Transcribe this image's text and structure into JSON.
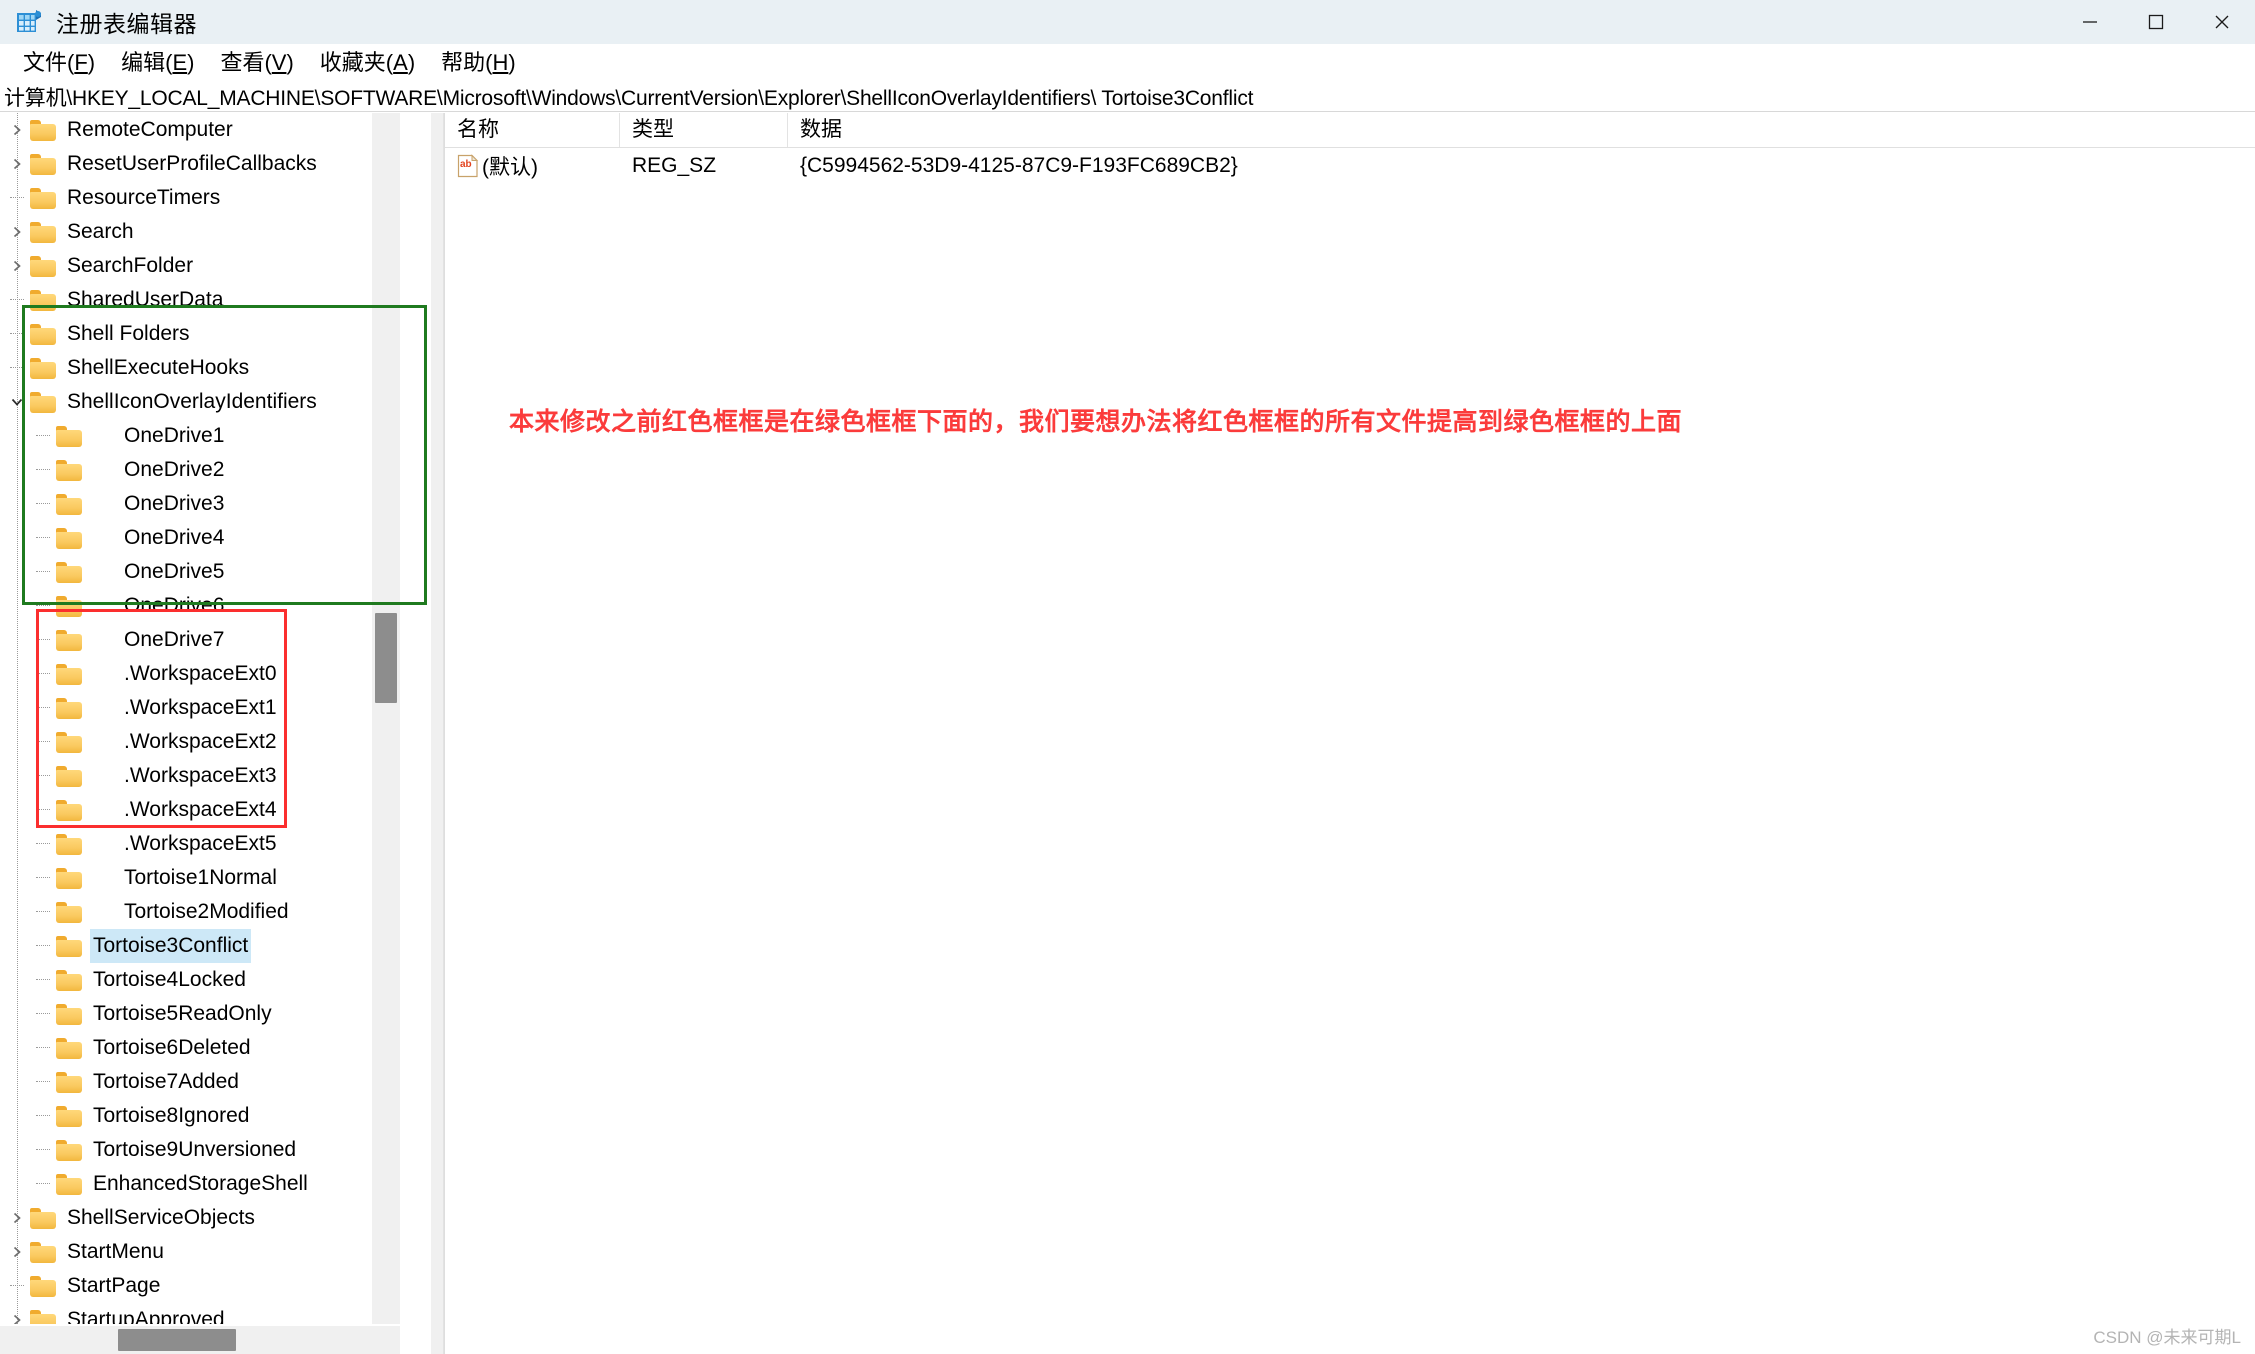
{
  "window": {
    "title": "注册表编辑器",
    "icon": "registry-editor-icon",
    "minimize_label": "—",
    "maximize_label": "☐",
    "close_label": "✕"
  },
  "menubar": {
    "items": [
      {
        "text": "文件(F)",
        "before": "文件(",
        "key": "F",
        "after": ")"
      },
      {
        "text": "编辑(E)",
        "before": "编辑(",
        "key": "E",
        "after": ")"
      },
      {
        "text": "查看(V)",
        "before": "查看(",
        "key": "V",
        "after": ")"
      },
      {
        "text": "收藏夹(A)",
        "before": "收藏夹(",
        "key": "A",
        "after": ")"
      },
      {
        "text": "帮助(H)",
        "before": "帮助(",
        "key": "H",
        "after": ")"
      }
    ]
  },
  "address": {
    "path": "计算机\\HKEY_LOCAL_MACHINE\\SOFTWARE\\Microsoft\\Windows\\CurrentVersion\\Explorer\\ShellIconOverlayIdentifiers\\ Tortoise3Conflict"
  },
  "tree": {
    "items": [
      {
        "label": "RemoteComputer",
        "level": 0,
        "expander": "collapsed"
      },
      {
        "label": "ResetUserProfileCallbacks",
        "level": 0,
        "expander": "collapsed"
      },
      {
        "label": "ResourceTimers",
        "level": 0,
        "expander": "none"
      },
      {
        "label": "Search",
        "level": 0,
        "expander": "collapsed"
      },
      {
        "label": "SearchFolder",
        "level": 0,
        "expander": "collapsed"
      },
      {
        "label": "SharedUserData",
        "level": 0,
        "expander": "none"
      },
      {
        "label": "Shell Folders",
        "level": 0,
        "expander": "none"
      },
      {
        "label": "ShellExecuteHooks",
        "level": 0,
        "expander": "none"
      },
      {
        "label": "ShellIconOverlayIdentifiers",
        "level": 0,
        "expander": "expanded"
      },
      {
        "label": "OneDrive1",
        "level": 1,
        "expander": "none",
        "extra_indent": true
      },
      {
        "label": "OneDrive2",
        "level": 1,
        "expander": "none",
        "extra_indent": true
      },
      {
        "label": "OneDrive3",
        "level": 1,
        "expander": "none",
        "extra_indent": true
      },
      {
        "label": "OneDrive4",
        "level": 1,
        "expander": "none",
        "extra_indent": true
      },
      {
        "label": "OneDrive5",
        "level": 1,
        "expander": "none",
        "extra_indent": true
      },
      {
        "label": "OneDrive6",
        "level": 1,
        "expander": "none",
        "extra_indent": true
      },
      {
        "label": "OneDrive7",
        "level": 1,
        "expander": "none",
        "extra_indent": true
      },
      {
        "label": ".WorkspaceExt0",
        "level": 1,
        "expander": "none",
        "extra_indent": true
      },
      {
        "label": ".WorkspaceExt1",
        "level": 1,
        "expander": "none",
        "extra_indent": true
      },
      {
        "label": ".WorkspaceExt2",
        "level": 1,
        "expander": "none",
        "extra_indent": true
      },
      {
        "label": ".WorkspaceExt3",
        "level": 1,
        "expander": "none",
        "extra_indent": true
      },
      {
        "label": ".WorkspaceExt4",
        "level": 1,
        "expander": "none",
        "extra_indent": true
      },
      {
        "label": ".WorkspaceExt5",
        "level": 1,
        "expander": "none",
        "extra_indent": true
      },
      {
        "label": "Tortoise1Normal",
        "level": 1,
        "expander": "none",
        "extra_indent": true
      },
      {
        "label": "Tortoise2Modified",
        "level": 1,
        "expander": "none",
        "extra_indent": true
      },
      {
        "label": "Tortoise3Conflict",
        "level": 1,
        "expander": "none",
        "selected": true
      },
      {
        "label": "Tortoise4Locked",
        "level": 1,
        "expander": "none"
      },
      {
        "label": "Tortoise5ReadOnly",
        "level": 1,
        "expander": "none"
      },
      {
        "label": "Tortoise6Deleted",
        "level": 1,
        "expander": "none"
      },
      {
        "label": "Tortoise7Added",
        "level": 1,
        "expander": "none"
      },
      {
        "label": "Tortoise8Ignored",
        "level": 1,
        "expander": "none"
      },
      {
        "label": "Tortoise9Unversioned",
        "level": 1,
        "expander": "none"
      },
      {
        "label": "EnhancedStorageShell",
        "level": 1,
        "expander": "none"
      },
      {
        "label": "ShellServiceObjects",
        "level": 0,
        "expander": "collapsed"
      },
      {
        "label": "StartMenu",
        "level": 0,
        "expander": "collapsed"
      },
      {
        "label": "StartPage",
        "level": 0,
        "expander": "none"
      },
      {
        "label": "StartupApproved",
        "level": 0,
        "expander": "collapsed"
      }
    ]
  },
  "listview": {
    "columns": [
      "名称",
      "类型",
      "数据"
    ],
    "rows": [
      {
        "icon": "ab-string-value-icon",
        "name": "(默认)",
        "type": "REG_SZ",
        "data": "{C5994562-53D9-4125-87C9-F193FC689CB2}"
      }
    ]
  },
  "annotations": {
    "note_text": "本来修改之前红色框框是在绿色框框下面的，我们要想办法将红色框框的所有文件提高到绿色框框的上面",
    "note_color": "#fb3b3b",
    "green_box_color": "#1f7a1f",
    "red_box_color": "#fb2e2e"
  },
  "watermark": {
    "text": "CSDN @未来可期L"
  }
}
